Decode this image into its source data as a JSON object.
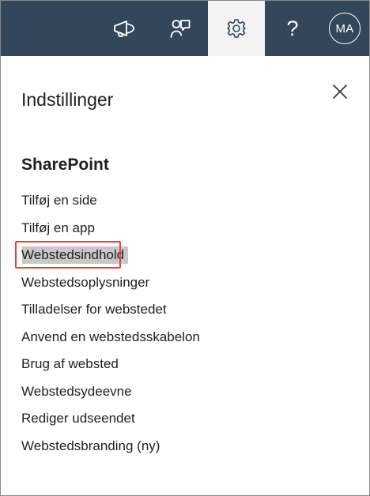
{
  "topbar": {
    "bg_color": "#33475b",
    "active_bg_color": "#f3f3f3",
    "icons": [
      "megaphone-icon",
      "feedback-icon",
      "gear-icon",
      "help-icon"
    ],
    "help_glyph": "?",
    "avatar_initials": "MA"
  },
  "panel": {
    "title": "Indstillinger",
    "close_icon": "close-icon"
  },
  "section": {
    "title": "SharePoint",
    "items": [
      {
        "label": "Tilføj en side"
      },
      {
        "label": "Tilføj en app"
      },
      {
        "label": "Webstedsindhold",
        "highlighted": true
      },
      {
        "label": "Webstedsoplysninger"
      },
      {
        "label": "Tilladelser for webstedet"
      },
      {
        "label": "Anvend en webstedsskabelon"
      },
      {
        "label": "Brug af websted"
      },
      {
        "label": "Webstedsydeevne"
      },
      {
        "label": "Rediger udseendet"
      },
      {
        "label": "Webstedsbranding (ny)"
      }
    ]
  },
  "highlight": {
    "box_color": "#e5423b",
    "fill_color": "#c8c8c8"
  }
}
